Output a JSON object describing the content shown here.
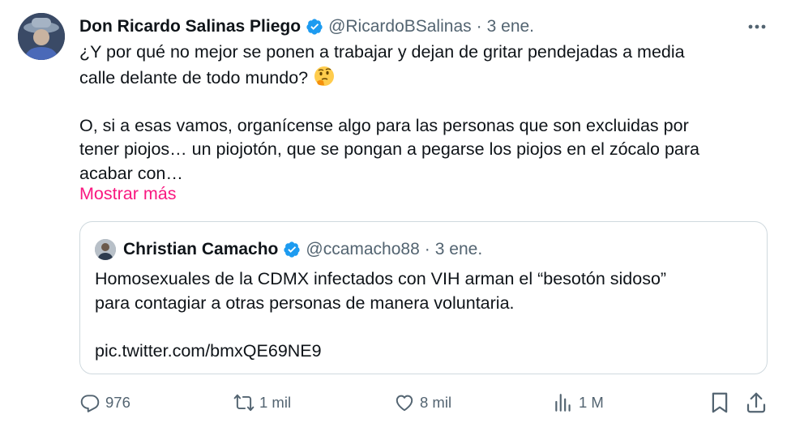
{
  "tweet": {
    "author_name": "Don Ricardo Salinas Pliego",
    "handle": "@RicardoBSalinas",
    "separator": "·",
    "date": "3 ene.",
    "text_line1": "¿Y por qué no mejor se ponen a trabajar y dejan de gritar pendejadas a media",
    "text_line2": "calle delante de todo mundo?",
    "text_line3": "O, si a esas vamos, organícense algo para las personas que son excluidas por",
    "text_line4": "tener piojos… un piojotón, que se pongan a  pegarse los piojos en el zócalo para",
    "text_line5": "acabar con…",
    "show_more": "Mostrar más",
    "emoji": "thinking-face-icon"
  },
  "quote": {
    "author_name": "Christian Camacho",
    "handle": "@ccamacho88",
    "separator": "·",
    "date": "3 ene.",
    "text_line1": "Homosexuales de la CDMX infectados con VIH arman el “besotón sidoso”",
    "text_line2": "para contagiar a otras personas de manera voluntaria.",
    "link": "pic.twitter.com/bmxQE69NE9"
  },
  "actions": {
    "replies": "976",
    "retweets": "1 mil",
    "likes": "8 mil",
    "views": "1 M"
  },
  "colors": {
    "text": "#0f1419",
    "secondary": "#536471",
    "verified": "#1d9bf0",
    "link_pink": "#f91880",
    "border": "#cfd9de"
  }
}
